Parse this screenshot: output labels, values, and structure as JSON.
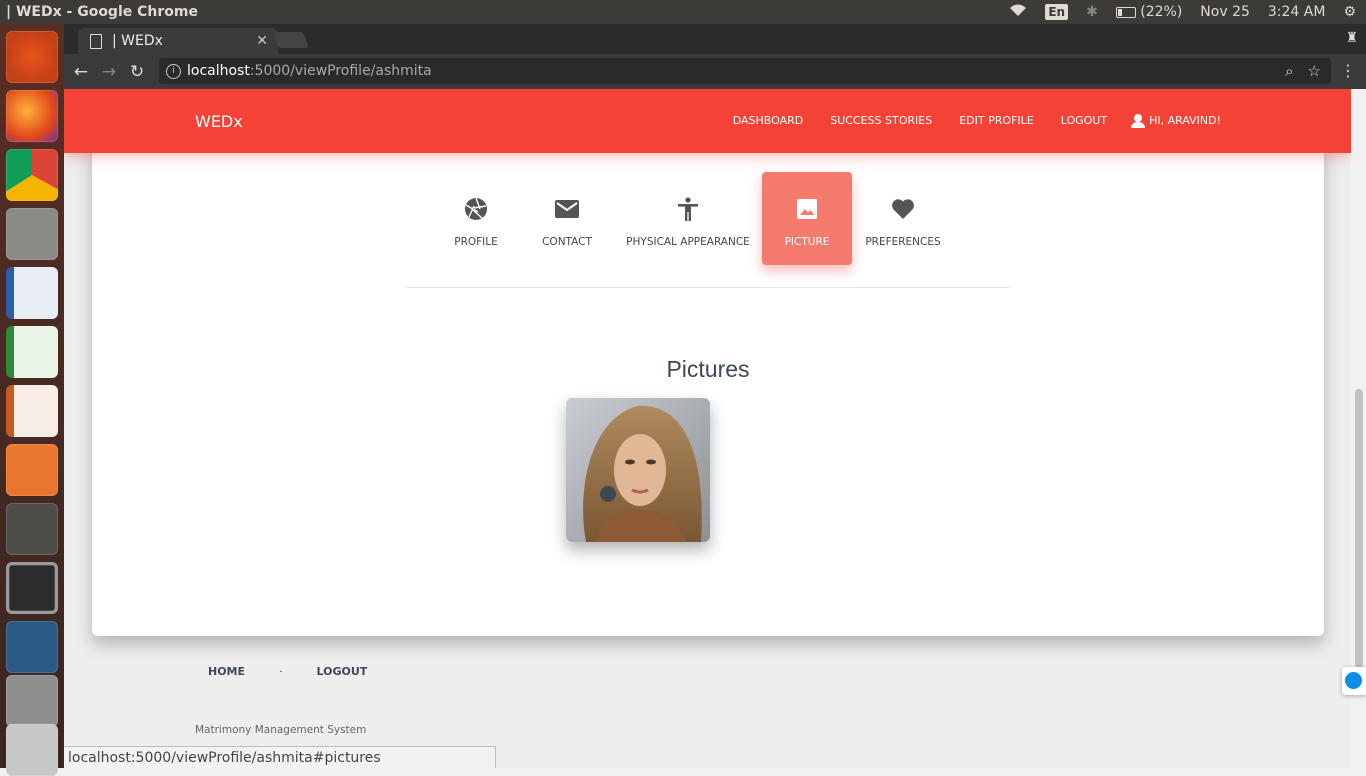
{
  "os": {
    "window_title": "| WEDx - Google Chrome",
    "lang": "En",
    "battery": "(22%)",
    "date": "Nov 25",
    "time": "3:24 AM"
  },
  "browser": {
    "tab_title": "| WEDx",
    "url_host": "localhost",
    "url_path": ":5000/viewProfile/ashmita",
    "status_url": "localhost:5000/viewProfile/ashmita#pictures"
  },
  "navbar": {
    "brand": "WEDx",
    "links": [
      "DASHBOARD",
      "SUCCESS STORIES",
      "EDIT PROFILE",
      "LOGOUT"
    ],
    "user_greeting": "HI, ARAVIND!"
  },
  "profile_tabs": [
    {
      "label": "PROFILE",
      "icon": "camera-aperture-icon"
    },
    {
      "label": "CONTACT",
      "icon": "mail-icon"
    },
    {
      "label": "PHYSICAL APPEARANCE",
      "icon": "accessibility-icon"
    },
    {
      "label": "PICTURE",
      "icon": "image-icon",
      "active": true
    },
    {
      "label": "PREFERENCES",
      "icon": "heart-icon"
    }
  ],
  "pictures": {
    "title": "Pictures"
  },
  "footer": {
    "links": [
      "HOME",
      "LOGOUT"
    ],
    "separator": "·",
    "tagline": "Matrimony Management System"
  },
  "colors": {
    "navbar": "#f44336",
    "active_tab": "#f47a6e"
  }
}
